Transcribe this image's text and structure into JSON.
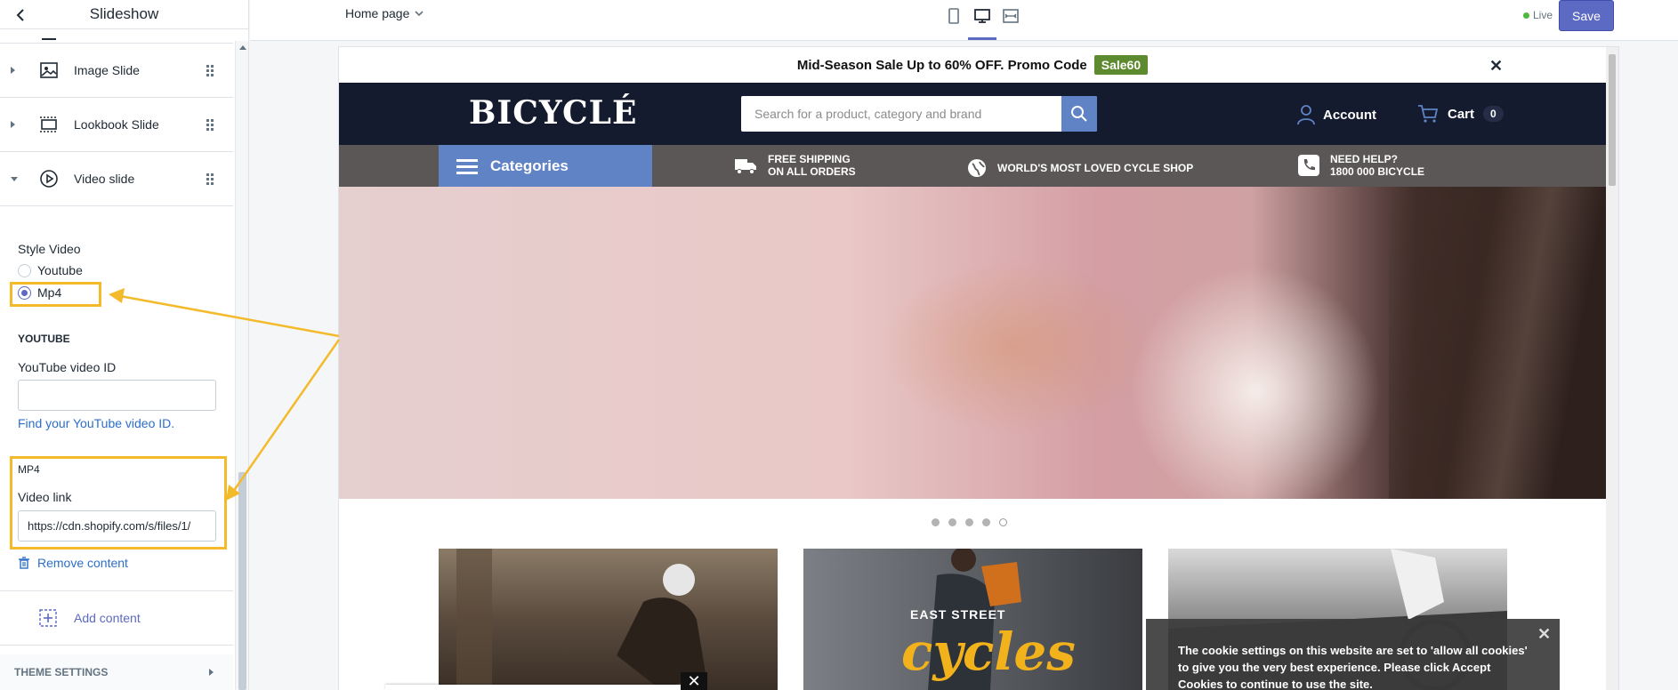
{
  "sidebar": {
    "title": "Slideshow",
    "blocks": [
      {
        "label": "Image Slide",
        "icon": "image-icon"
      },
      {
        "label": "Lookbook Slide",
        "icon": "lookbook-icon"
      },
      {
        "label": "Video slide",
        "icon": "play-circle-icon"
      }
    ],
    "style_video_label": "Style Video",
    "style_options": [
      "Youtube",
      "Mp4"
    ],
    "style_selected": "Mp4",
    "youtube_heading": "YOUTUBE",
    "youtube_id_label": "YouTube video ID",
    "youtube_id_value": "",
    "youtube_help_link": "Find your YouTube video ID.",
    "mp4_heading": "MP4",
    "video_link_label": "Video link",
    "video_link_value": "https://cdn.shopify.com/s/files/1/",
    "remove_label": "Remove content",
    "add_label": "Add content",
    "theme_settings_label": "THEME SETTINGS"
  },
  "topbar": {
    "page_select": "Home page",
    "live_label": "Live",
    "save_label": "Save"
  },
  "preview": {
    "promo_text": "Mid-Season Sale Up to 60% OFF. Promo Code",
    "promo_code": "Sale60",
    "logo": "BICYCLÉ",
    "search_placeholder": "Search for a product, category and brand",
    "account_label": "Account",
    "cart_label": "Cart",
    "cart_count": "0",
    "categories_label": "Categories",
    "features": [
      {
        "line1": "FREE SHIPPING",
        "line2": "ON ALL ORDERS",
        "icon": "truck-icon"
      },
      {
        "line1": "WORLD'S MOST LOVED CYCLE SHOP",
        "line2": "",
        "icon": "globe-icon"
      },
      {
        "line1": "NEED HELP?",
        "line2": "1800 000 BICYCLE",
        "icon": "phone-icon"
      }
    ],
    "card2_title_small": "EAST STREET",
    "card2_title_big": "cycles",
    "cookie_text": "The cookie settings on this website are set to 'allow all cookies' to give you the very best experience. Please click Accept Cookies to continue to use the site."
  },
  "colors": {
    "accent": "#5c6ac4",
    "highlight": "#f3bb2b",
    "nav_bg": "#141b2e",
    "categories_bg": "#6083c6",
    "promo_code_bg": "#5d8a2e"
  }
}
